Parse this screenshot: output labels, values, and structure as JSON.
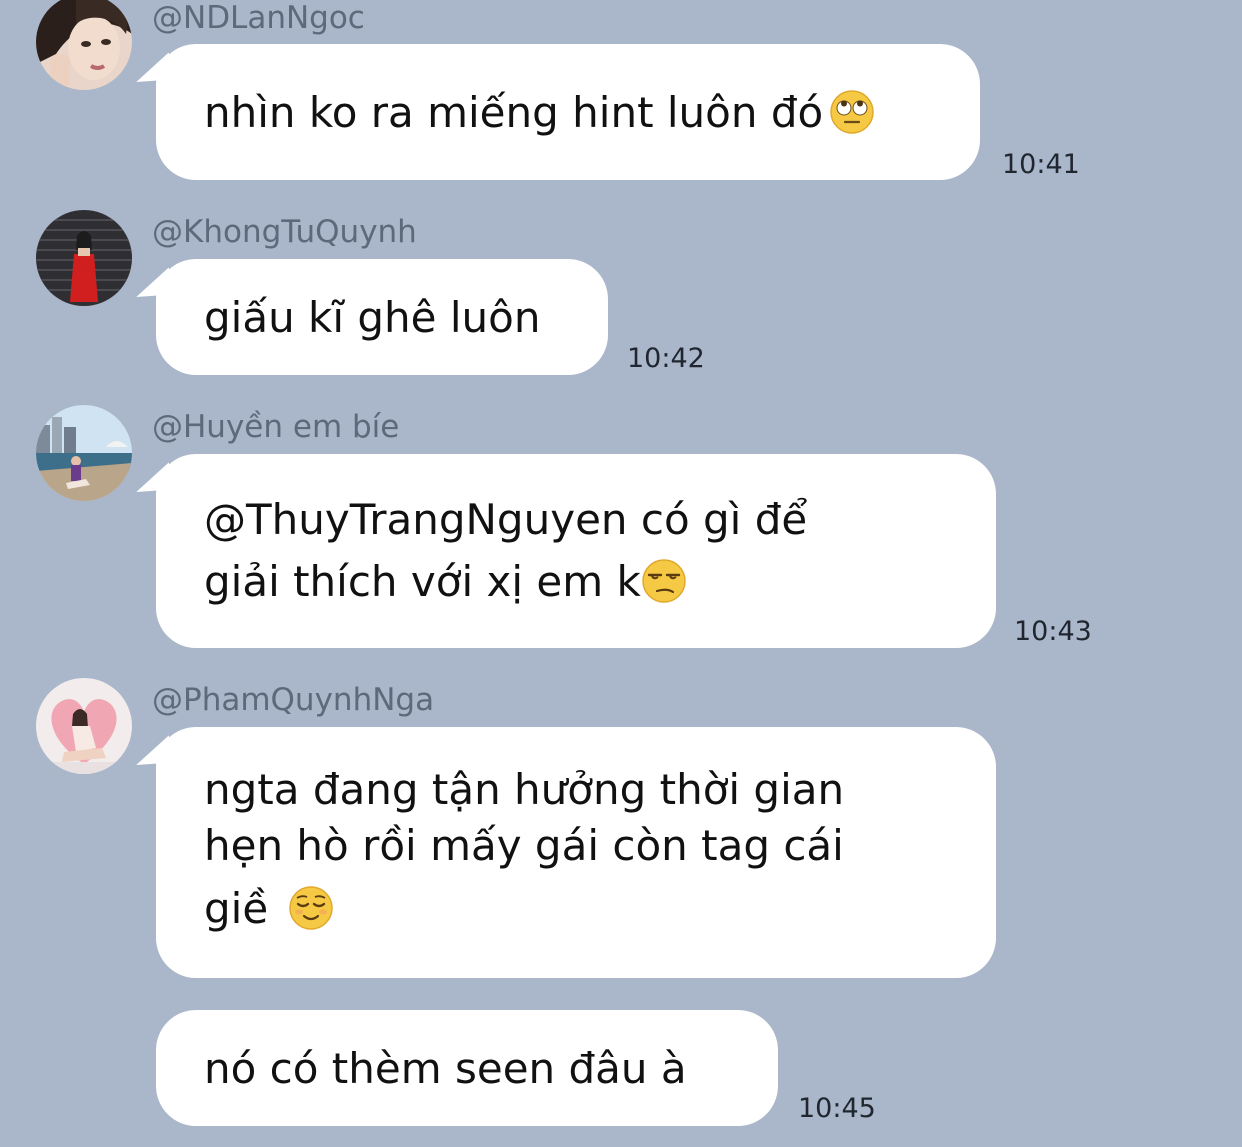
{
  "messages": [
    {
      "user": "@NDLanNgoc",
      "avatar_icon": "user-avatar-photo",
      "lines": [
        "nhìn ko ra miếng hint luôn đó"
      ],
      "emoji": "face-with-rolling-eyes-emoji",
      "time": "10:41"
    },
    {
      "user": "@KhongTuQuynh",
      "avatar_icon": "user-avatar-photo",
      "lines": [
        "giấu kĩ ghê luôn"
      ],
      "time": "10:42"
    },
    {
      "user": "@Huyền em bíe",
      "avatar_icon": "user-avatar-photo",
      "lines": [
        "@ThuyTrangNguyen có gì để",
        "giải thích với xị em k"
      ],
      "emoji": "unamused-face-emoji",
      "time": "10:43"
    },
    {
      "user": "@PhamQuynhNga",
      "avatar_icon": "user-avatar-photo",
      "lines": [
        "ngta đang tận hưởng thời gian",
        "hẹn hò rồi mấy gái còn tag cái",
        "giề"
      ],
      "emoji": "relieved-face-emoji",
      "time": ""
    },
    {
      "lines": [
        "nó có thèm seen đâu à"
      ],
      "time": "10:45"
    }
  ],
  "colors": {
    "background": "#aab6c9",
    "bubble": "#ffffff",
    "username": "#5d6a7c",
    "text": "#111111"
  }
}
